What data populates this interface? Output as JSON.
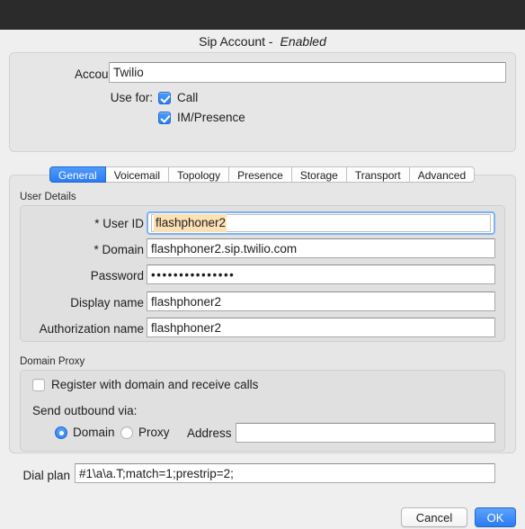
{
  "window": {
    "title_prefix": "Sip Account - ",
    "title_status": "Enabled"
  },
  "account": {
    "name_label": "Account name:",
    "name_value": "Twilio",
    "name_placeholder": "",
    "use_for_label": "Use for:",
    "use_for": [
      {
        "label": "Call",
        "checked": true
      },
      {
        "label": "IM/Presence",
        "checked": true
      }
    ]
  },
  "tabs": [
    {
      "label": "General",
      "active": true
    },
    {
      "label": "Voicemail",
      "active": false
    },
    {
      "label": "Topology",
      "active": false
    },
    {
      "label": "Presence",
      "active": false
    },
    {
      "label": "Storage",
      "active": false
    },
    {
      "label": "Transport",
      "active": false
    },
    {
      "label": "Advanced",
      "active": false
    }
  ],
  "user_details": {
    "group_title": "User Details",
    "user_id_label": "* User ID",
    "user_id_value": "flashphoner2",
    "domain_label": "* Domain",
    "domain_value": "flashphoner2.sip.twilio.com",
    "password_label": "Password",
    "password_value": "•••••••••••••••",
    "display_name_label": "Display name",
    "display_name_value": "flashphoner2",
    "authorization_name_label": "Authorization name",
    "authorization_name_value": "flashphoner2"
  },
  "domain_proxy": {
    "group_title": "Domain Proxy",
    "register_label": "Register with domain and receive calls",
    "register_checked": false,
    "send_outbound_label": "Send outbound via:",
    "option_domain": "Domain",
    "option_proxy": "Proxy",
    "selected_option": "Domain",
    "address_label": "Address",
    "address_value": "",
    "address_placeholder": ""
  },
  "dial_plan": {
    "label": "Dial plan",
    "value": "#1\\a\\a.T;match=1;prestrip=2;",
    "placeholder": ""
  },
  "footer": {
    "cancel_label": "Cancel",
    "ok_label": "OK"
  },
  "colors": {
    "accent_blue": "#2b7bf3",
    "selection_orange": "#fde0b4",
    "focus_ring": "#7bb3f2",
    "titlebar": "#2b2b2b",
    "window_bg": "#efefef"
  }
}
